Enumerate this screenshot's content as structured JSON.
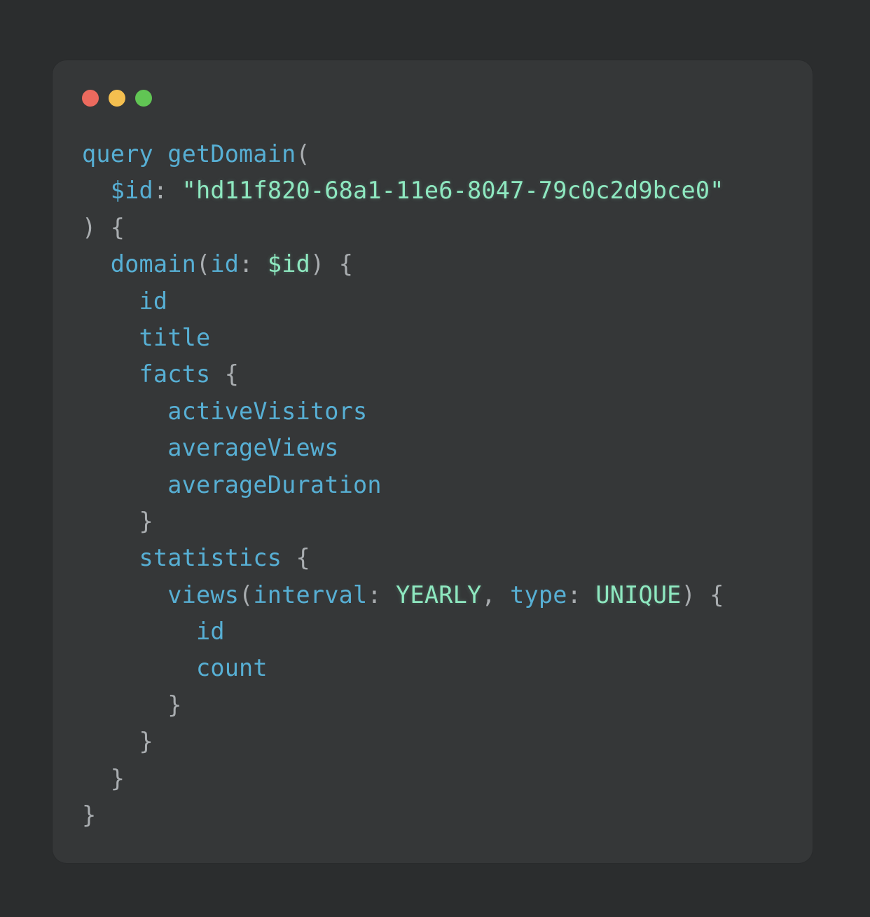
{
  "colors": {
    "background": "#2b2d2e",
    "window": "#353738",
    "close": "#ec6a5e",
    "minimize": "#f4bf4f",
    "maximize": "#61c554",
    "identifier": "#57afd4",
    "punctuation": "#a9adb0",
    "literal": "#8ee8c0"
  },
  "code": {
    "lines": [
      [
        {
          "t": "kw",
          "v": "query"
        },
        {
          "t": "ws",
          "v": " "
        },
        {
          "t": "fn",
          "v": "getDomain"
        },
        {
          "t": "punct",
          "v": "("
        }
      ],
      [
        {
          "t": "ws",
          "v": "  "
        },
        {
          "t": "var",
          "v": "$id"
        },
        {
          "t": "punct",
          "v": ": "
        },
        {
          "t": "str",
          "v": "\"hd11f820-68a1-11e6-8047-79c0c2d9bce0\""
        }
      ],
      [
        {
          "t": "punct",
          "v": ") {"
        }
      ],
      [
        {
          "t": "ws",
          "v": "  "
        },
        {
          "t": "field",
          "v": "domain"
        },
        {
          "t": "punct",
          "v": "("
        },
        {
          "t": "field",
          "v": "id"
        },
        {
          "t": "punct",
          "v": ": "
        },
        {
          "t": "val",
          "v": "$id"
        },
        {
          "t": "punct",
          "v": ") {"
        }
      ],
      [
        {
          "t": "ws",
          "v": "    "
        },
        {
          "t": "field",
          "v": "id"
        }
      ],
      [
        {
          "t": "ws",
          "v": "    "
        },
        {
          "t": "field",
          "v": "title"
        }
      ],
      [
        {
          "t": "ws",
          "v": "    "
        },
        {
          "t": "field",
          "v": "facts"
        },
        {
          "t": "punct",
          "v": " {"
        }
      ],
      [
        {
          "t": "ws",
          "v": "      "
        },
        {
          "t": "field",
          "v": "activeVisitors"
        }
      ],
      [
        {
          "t": "ws",
          "v": "      "
        },
        {
          "t": "field",
          "v": "averageViews"
        }
      ],
      [
        {
          "t": "ws",
          "v": "      "
        },
        {
          "t": "field",
          "v": "averageDuration"
        }
      ],
      [
        {
          "t": "ws",
          "v": "    "
        },
        {
          "t": "punct",
          "v": "}"
        }
      ],
      [
        {
          "t": "ws",
          "v": "    "
        },
        {
          "t": "field",
          "v": "statistics"
        },
        {
          "t": "punct",
          "v": " {"
        }
      ],
      [
        {
          "t": "ws",
          "v": "      "
        },
        {
          "t": "field",
          "v": "views"
        },
        {
          "t": "punct",
          "v": "("
        },
        {
          "t": "field",
          "v": "interval"
        },
        {
          "t": "punct",
          "v": ": "
        },
        {
          "t": "val",
          "v": "YEARLY"
        },
        {
          "t": "punct",
          "v": ", "
        },
        {
          "t": "field",
          "v": "type"
        },
        {
          "t": "punct",
          "v": ": "
        },
        {
          "t": "val",
          "v": "UNIQUE"
        },
        {
          "t": "punct",
          "v": ") {"
        }
      ],
      [
        {
          "t": "ws",
          "v": "        "
        },
        {
          "t": "field",
          "v": "id"
        }
      ],
      [
        {
          "t": "ws",
          "v": "        "
        },
        {
          "t": "field",
          "v": "count"
        }
      ],
      [
        {
          "t": "ws",
          "v": "      "
        },
        {
          "t": "punct",
          "v": "}"
        }
      ],
      [
        {
          "t": "ws",
          "v": "    "
        },
        {
          "t": "punct",
          "v": "}"
        }
      ],
      [
        {
          "t": "ws",
          "v": "  "
        },
        {
          "t": "punct",
          "v": "}"
        }
      ],
      [
        {
          "t": "punct",
          "v": "}"
        }
      ]
    ]
  }
}
